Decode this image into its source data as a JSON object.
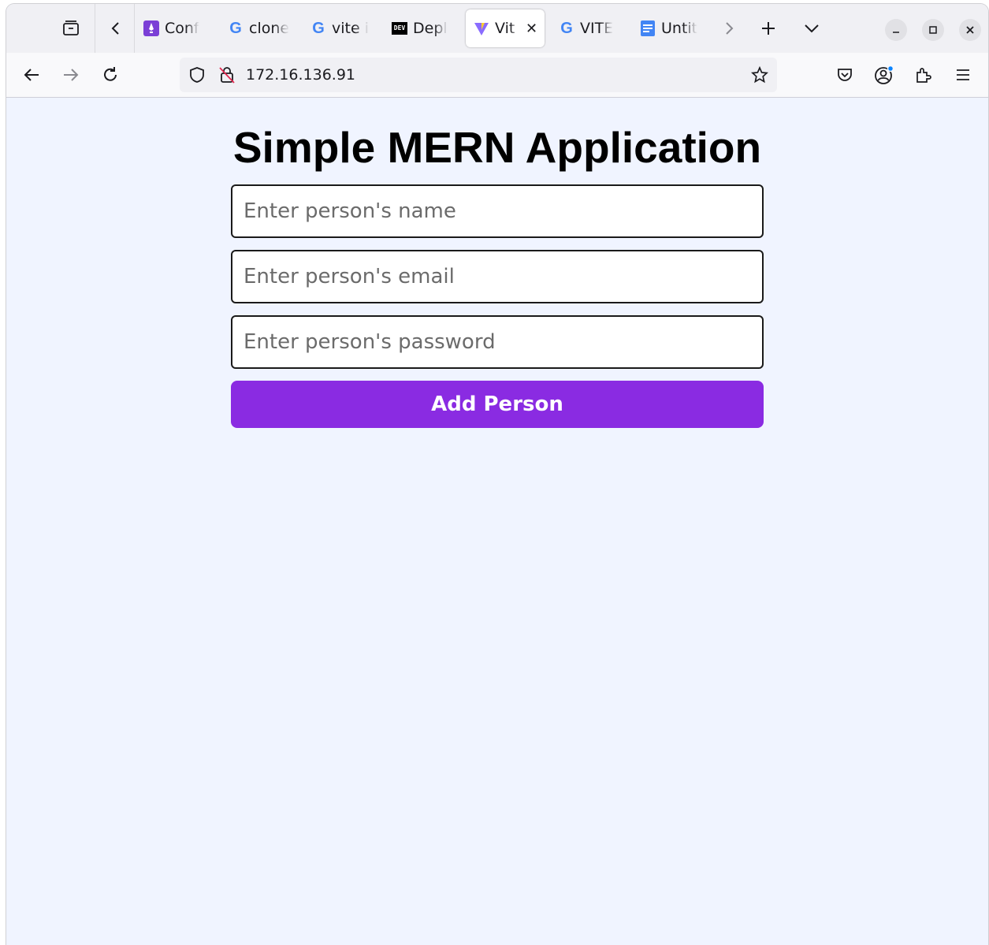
{
  "browser": {
    "tabs": [
      {
        "label": "Conf",
        "icon": "rocket-favicon-icon",
        "color": "#7b3fd6"
      },
      {
        "label": "clone",
        "icon": "google-favicon-icon",
        "color": "#4285f4"
      },
      {
        "label": "vite i",
        "icon": "google-favicon-icon",
        "color": "#4285f4"
      },
      {
        "label": "Depl",
        "icon": "dev-favicon-icon",
        "badge": "DEV"
      },
      {
        "label": "Vit",
        "icon": "vite-favicon-icon",
        "active": true
      },
      {
        "label": "VITE",
        "icon": "google-favicon-icon",
        "color": "#4285f4"
      },
      {
        "label": "Untit",
        "icon": "docs-favicon-icon",
        "color": "#4285f4"
      }
    ],
    "url": "172.16.136.91"
  },
  "app": {
    "title": "Simple MERN Application",
    "name_placeholder": "Enter person's name",
    "email_placeholder": "Enter person's email",
    "password_placeholder": "Enter person's password",
    "add_button_label": "Add Person"
  },
  "colors": {
    "page_background": "#f0f4ff",
    "button_accent": "#8a2be2"
  }
}
